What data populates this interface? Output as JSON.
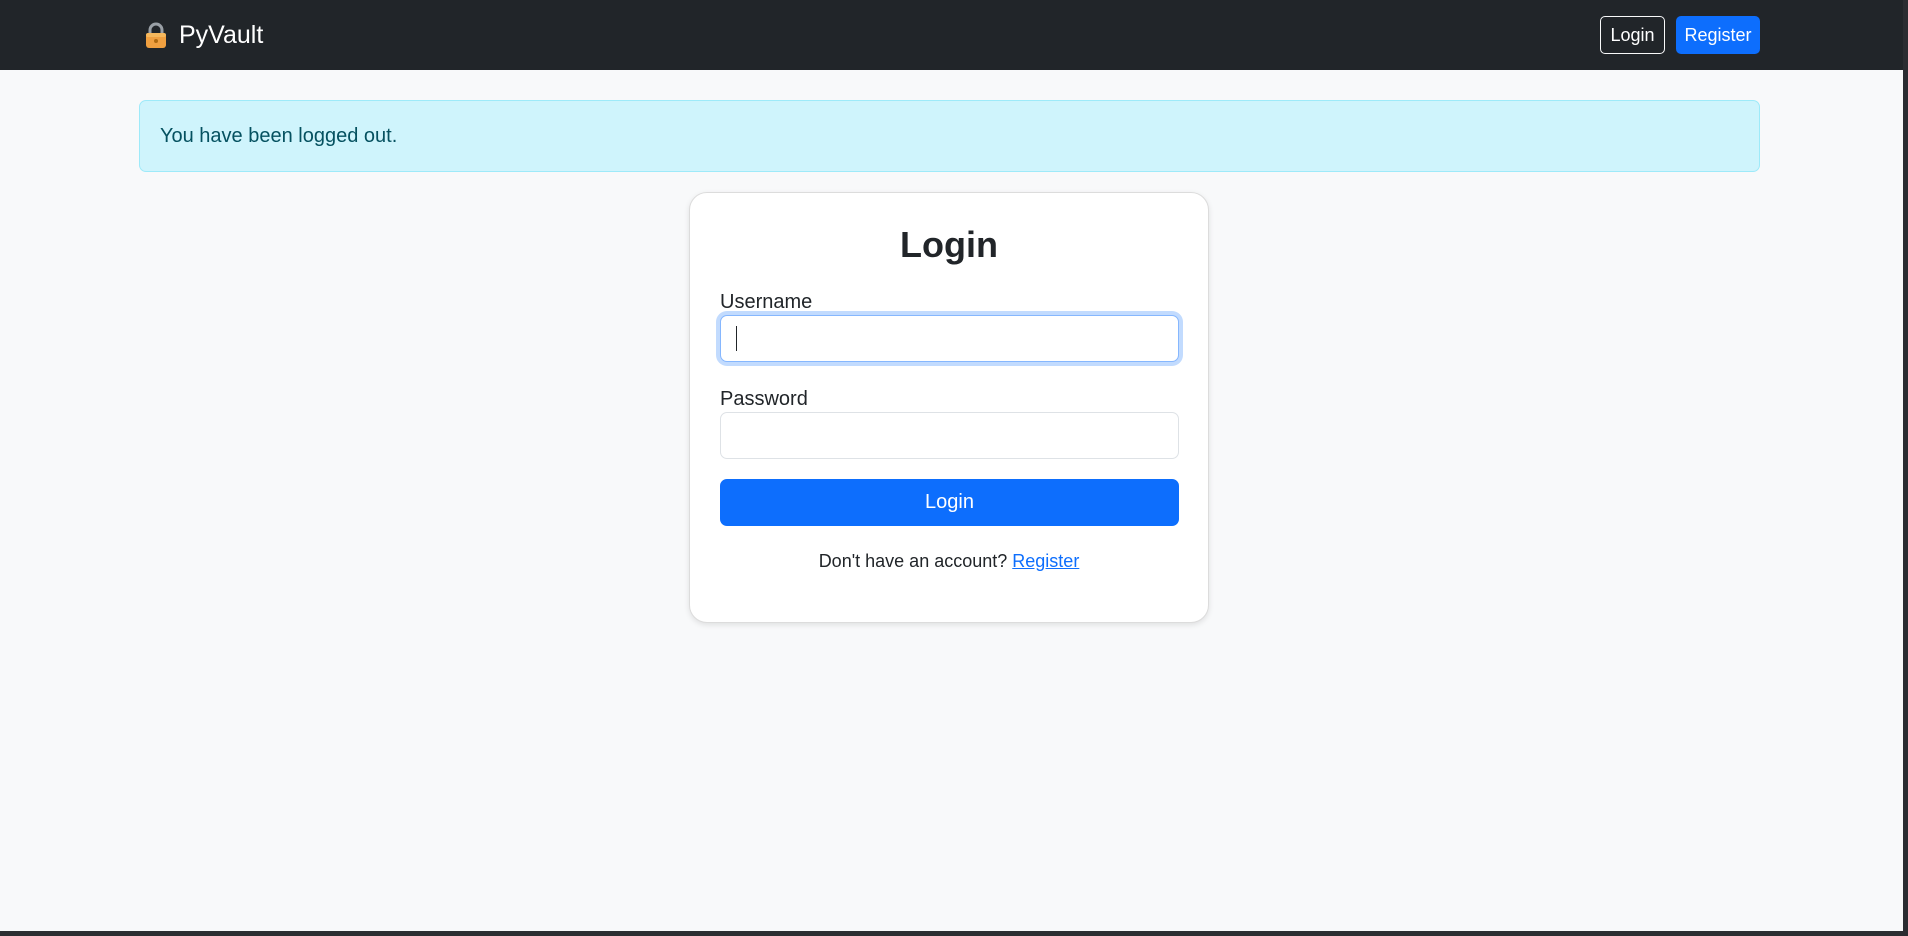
{
  "navbar": {
    "brand_icon": "lock-icon",
    "brand_name": "PyVault",
    "login_label": "Login",
    "register_label": "Register"
  },
  "alert": {
    "message": "You have been logged out."
  },
  "login_card": {
    "title": "Login",
    "username_label": "Username",
    "username_value": "",
    "password_label": "Password",
    "password_value": "",
    "submit_label": "Login",
    "register_prompt": "Don't have an account?",
    "register_link": "Register"
  },
  "colors": {
    "navbar_bg": "#212529",
    "primary": "#0d6efd",
    "alert_bg": "#cff4fc",
    "alert_text": "#055160",
    "page_bg": "#f8f9fa",
    "lock_icon": "#f0a040"
  }
}
